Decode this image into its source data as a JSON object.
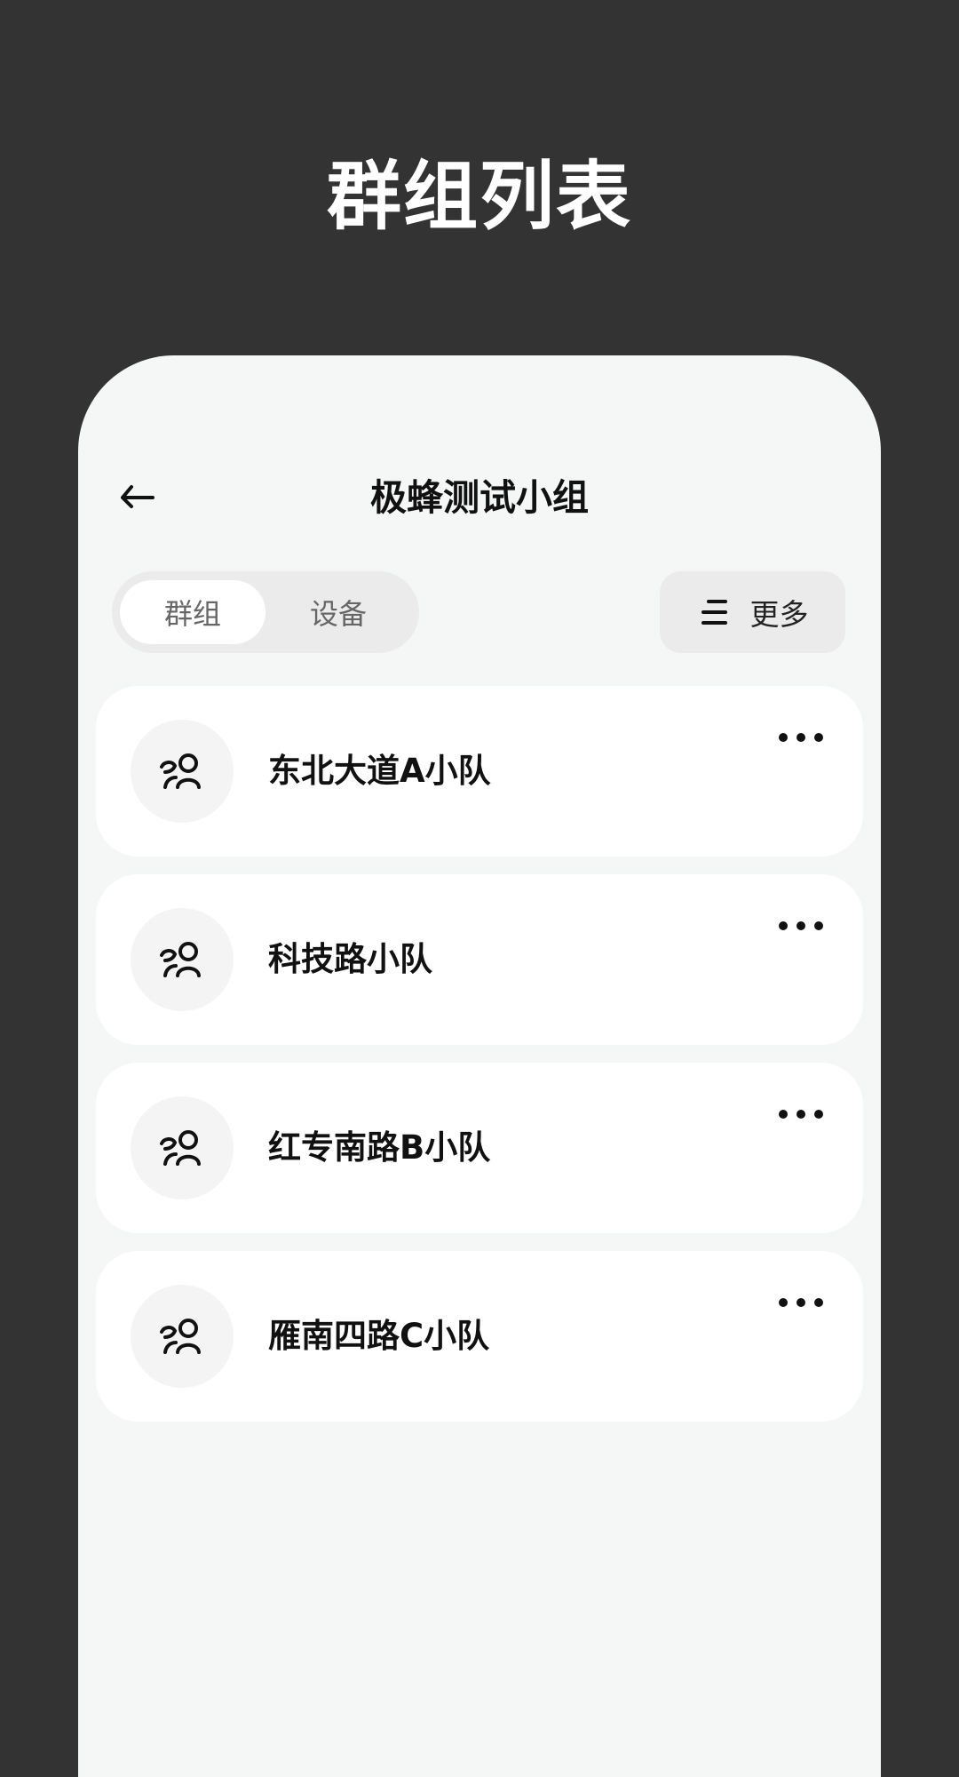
{
  "promo": {
    "title": "群组列表"
  },
  "header": {
    "back_icon": "arrow-left-icon",
    "title": "极蜂测试小组"
  },
  "tabs": [
    {
      "label": "群组",
      "active": true
    },
    {
      "label": "设备",
      "active": false
    }
  ],
  "more_button": {
    "icon": "menu-lines-icon",
    "label": "更多"
  },
  "groups": [
    {
      "name": "东北大道A小队",
      "avatar_icon": "group-icon",
      "action_icon": "more-dots-icon"
    },
    {
      "name": "科技路小队",
      "avatar_icon": "group-icon",
      "action_icon": "more-dots-icon"
    },
    {
      "name": "红专南路B小队",
      "avatar_icon": "group-icon",
      "action_icon": "more-dots-icon"
    },
    {
      "name": "雁南四路C小队",
      "avatar_icon": "group-icon",
      "action_icon": "more-dots-icon"
    }
  ],
  "colors": {
    "page_background": "#333333",
    "screen_background": "#f5f6f6",
    "card_background": "#ffffff",
    "segment_background": "#ebebeb",
    "primary_text": "#111111",
    "muted_text": "#666666"
  }
}
